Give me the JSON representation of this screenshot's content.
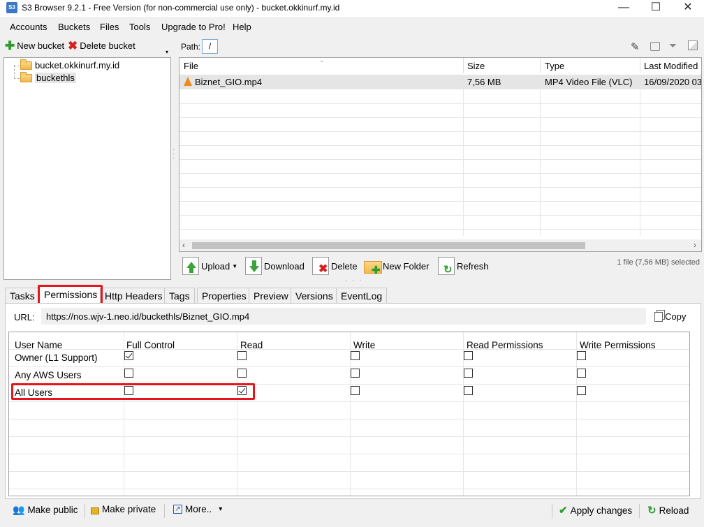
{
  "window": {
    "app_icon": "S3",
    "title": "S3 Browser 9.2.1 - Free Version (for non-commercial use only) - bucket.okkinurf.my.id",
    "minimize": "—",
    "maximize": "☐",
    "close": "✕"
  },
  "menu": [
    "Accounts",
    "Buckets",
    "Files",
    "Tools",
    "Upgrade to Pro!",
    "Help"
  ],
  "left_toolbar": {
    "new_bucket": "New bucket",
    "delete_bucket": "Delete bucket"
  },
  "buckets": [
    "bucket.okkinurf.my.id",
    "buckethls"
  ],
  "path": {
    "label": "Path:",
    "value": "/"
  },
  "files": {
    "columns": [
      "File",
      "Size",
      "Type",
      "Last Modified"
    ],
    "rows": [
      {
        "name": "Biznet_GIO.mp4",
        "size": "7,56 MB",
        "type": "MP4 Video File (VLC)",
        "modified": "16/09/2020 03."
      }
    ]
  },
  "file_toolbar": {
    "upload": "Upload",
    "download": "Download",
    "delete": "Delete",
    "new_folder": "New Folder",
    "refresh": "Refresh",
    "status": "1 file (7,56 MB) selected"
  },
  "tabs": [
    "Tasks",
    "Permissions",
    "Http Headers",
    "Tags",
    "Properties",
    "Preview",
    "Versions",
    "EventLog"
  ],
  "active_tab": "Permissions",
  "url": {
    "label": "URL:",
    "value": "https://nos.wjv-1.neo.id/buckethls/Biznet_GIO.mp4",
    "copy": "Copy"
  },
  "permissions": {
    "columns": [
      "User Name",
      "Full Control",
      "Read",
      "Write",
      "Read Permissions",
      "Write Permissions"
    ],
    "rows": [
      {
        "user": "Owner (L1 Support)",
        "checks": [
          true,
          false,
          false,
          false,
          false
        ]
      },
      {
        "user": "Any AWS Users",
        "checks": [
          false,
          false,
          false,
          false,
          false
        ]
      },
      {
        "user": "All Users",
        "checks": [
          false,
          true,
          false,
          false,
          false
        ]
      }
    ]
  },
  "bottom_toolbar": {
    "make_public": "Make public",
    "make_private": "Make private",
    "more": "More..",
    "more_arrow": "▾",
    "apply": "Apply changes",
    "reload": "Reload"
  },
  "colors": {
    "highlight": "#e8141c",
    "selection": "#e5e5e5"
  }
}
